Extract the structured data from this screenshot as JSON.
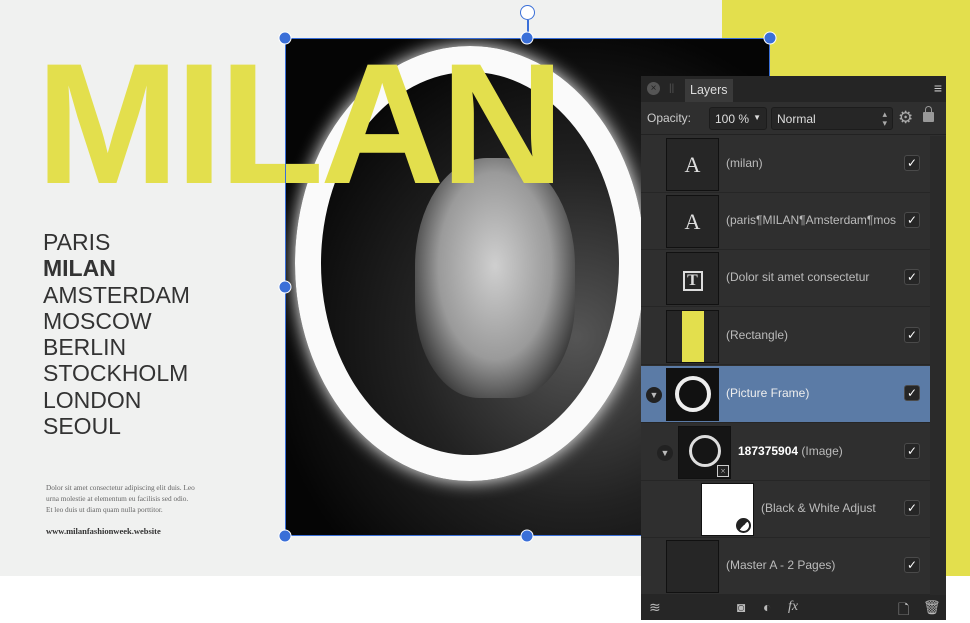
{
  "canvas": {
    "title": "MILAN",
    "cities": [
      "PARIS",
      "MILAN",
      "AMSTERDAM",
      "MOSCOW",
      "BERLIN",
      "STOCKHOLM",
      "LONDON",
      "SEOUL"
    ],
    "bold_city_index": 1,
    "blurb": "Dolor sit amet consectetur adipiscing elit duis. Leo urna molestie at elementum eu facilisis sed odio. Et leo duis ut diam quam nulla porttitor.",
    "url": "www.milanfashionweek.website",
    "accent": "#e3df4d"
  },
  "panel": {
    "tab": "Layers",
    "opacity_label": "Opacity:",
    "opacity_value": "100 %",
    "blend_mode": "Normal",
    "selection_color": "#5b7ba6",
    "layers": [
      {
        "thumb": "A",
        "name": "(milan)"
      },
      {
        "thumb": "A",
        "name": "(paris¶MILAN¶Amsterdam¶moscow"
      },
      {
        "thumb": "T",
        "name": "(Dolor sit amet consectetur"
      },
      {
        "thumb": "",
        "name": "(Rectangle)"
      },
      {
        "thumb": "",
        "name": "(Picture Frame)"
      },
      {
        "thumb": "",
        "id": "187375904",
        "name": "(Image)"
      },
      {
        "thumb": "",
        "name": "(Black & White Adjust"
      },
      {
        "thumb": "",
        "name": "(Master A - 2 Pages)"
      }
    ]
  }
}
